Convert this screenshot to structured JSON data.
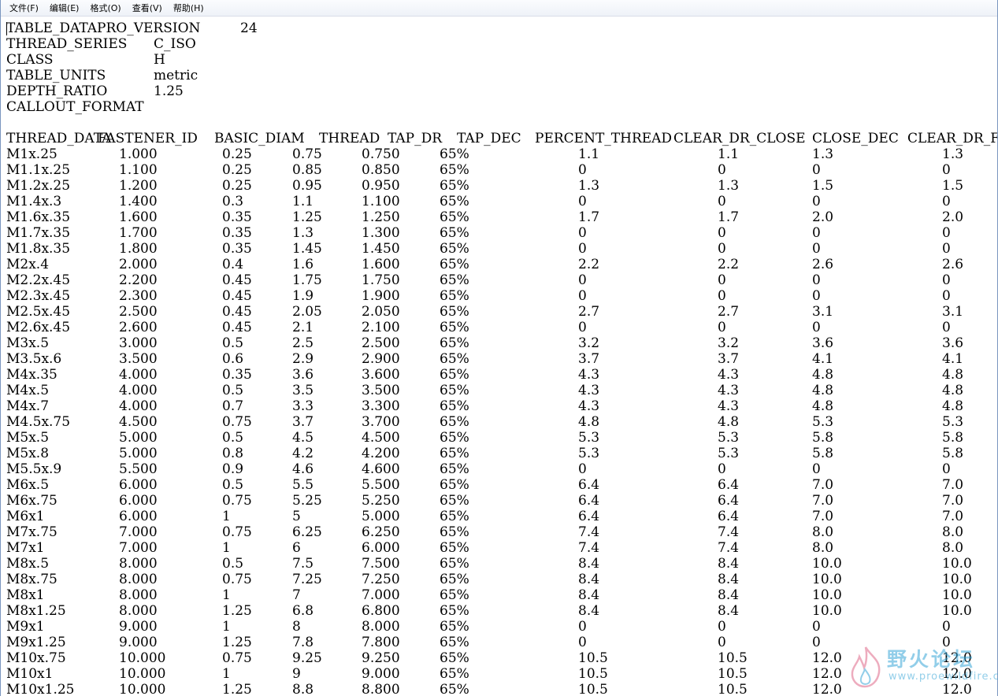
{
  "menubar": {
    "items": [
      "文件(F)",
      "编辑(E)",
      "格式(O)",
      "查看(V)",
      "帮助(H)"
    ]
  },
  "header_rows": [
    {
      "key": "TABLE_DATAPRO_VERSION",
      "value": "24"
    },
    {
      "key": "THREAD_SERIES",
      "value": "C_ISO"
    },
    {
      "key": "CLASS",
      "value": "H"
    },
    {
      "key": "TABLE_UNITS",
      "value": "metric"
    },
    {
      "key": "DEPTH_RATIO",
      "value": "1.25"
    },
    {
      "key": "CALLOUT_FORMAT",
      "value": ""
    }
  ],
  "table": {
    "columns": [
      "THREAD_DATA",
      "FASTENER_ID",
      "BASIC_DIAM",
      "THREAD",
      "TAP_DR",
      "TAP_DEC",
      "PERCENT_THREAD",
      "CLEAR_DR_CLOSE",
      "CLOSE_DEC",
      "CLEAR_DR_FR"
    ],
    "rows": [
      [
        "M1x.25",
        "1.000",
        "0.25",
        "0.75",
        "0.750",
        "65%",
        "1.1",
        "1.1",
        "1.3",
        "1.3"
      ],
      [
        "M1.1x.25",
        "1.100",
        "0.25",
        "0.85",
        "0.850",
        "65%",
        "0",
        "0",
        "0",
        "0"
      ],
      [
        "M1.2x.25",
        "1.200",
        "0.25",
        "0.95",
        "0.950",
        "65%",
        "1.3",
        "1.3",
        "1.5",
        "1.5"
      ],
      [
        "M1.4x.3",
        "1.400",
        "0.3",
        "1.1",
        "1.100",
        "65%",
        "0",
        "0",
        "0",
        "0"
      ],
      [
        "M1.6x.35",
        "1.600",
        "0.35",
        "1.25",
        "1.250",
        "65%",
        "1.7",
        "1.7",
        "2.0",
        "2.0"
      ],
      [
        "M1.7x.35",
        "1.700",
        "0.35",
        "1.3",
        "1.300",
        "65%",
        "0",
        "0",
        "0",
        "0"
      ],
      [
        "M1.8x.35",
        "1.800",
        "0.35",
        "1.45",
        "1.450",
        "65%",
        "0",
        "0",
        "0",
        "0"
      ],
      [
        "M2x.4",
        "2.000",
        "0.4",
        "1.6",
        "1.600",
        "65%",
        "2.2",
        "2.2",
        "2.6",
        "2.6"
      ],
      [
        "M2.2x.45",
        "2.200",
        "0.45",
        "1.75",
        "1.750",
        "65%",
        "0",
        "0",
        "0",
        "0"
      ],
      [
        "M2.3x.45",
        "2.300",
        "0.45",
        "1.9",
        "1.900",
        "65%",
        "0",
        "0",
        "0",
        "0"
      ],
      [
        "M2.5x.45",
        "2.500",
        "0.45",
        "2.05",
        "2.050",
        "65%",
        "2.7",
        "2.7",
        "3.1",
        "3.1"
      ],
      [
        "M2.6x.45",
        "2.600",
        "0.45",
        "2.1",
        "2.100",
        "65%",
        "0",
        "0",
        "0",
        "0"
      ],
      [
        "M3x.5",
        "3.000",
        "0.5",
        "2.5",
        "2.500",
        "65%",
        "3.2",
        "3.2",
        "3.6",
        "3.6"
      ],
      [
        "M3.5x.6",
        "3.500",
        "0.6",
        "2.9",
        "2.900",
        "65%",
        "3.7",
        "3.7",
        "4.1",
        "4.1"
      ],
      [
        "M4x.35",
        "4.000",
        "0.35",
        "3.6",
        "3.600",
        "65%",
        "4.3",
        "4.3",
        "4.8",
        "4.8"
      ],
      [
        "M4x.5",
        "4.000",
        "0.5",
        "3.5",
        "3.500",
        "65%",
        "4.3",
        "4.3",
        "4.8",
        "4.8"
      ],
      [
        "M4x.7",
        "4.000",
        "0.7",
        "3.3",
        "3.300",
        "65%",
        "4.3",
        "4.3",
        "4.8",
        "4.8"
      ],
      [
        "M4.5x.75",
        "4.500",
        "0.75",
        "3.7",
        "3.700",
        "65%",
        "4.8",
        "4.8",
        "5.3",
        "5.3"
      ],
      [
        "M5x.5",
        "5.000",
        "0.5",
        "4.5",
        "4.500",
        "65%",
        "5.3",
        "5.3",
        "5.8",
        "5.8"
      ],
      [
        "M5x.8",
        "5.000",
        "0.8",
        "4.2",
        "4.200",
        "65%",
        "5.3",
        "5.3",
        "5.8",
        "5.8"
      ],
      [
        "M5.5x.9",
        "5.500",
        "0.9",
        "4.6",
        "4.600",
        "65%",
        "0",
        "0",
        "0",
        "0"
      ],
      [
        "M6x.5",
        "6.000",
        "0.5",
        "5.5",
        "5.500",
        "65%",
        "6.4",
        "6.4",
        "7.0",
        "7.0"
      ],
      [
        "M6x.75",
        "6.000",
        "0.75",
        "5.25",
        "5.250",
        "65%",
        "6.4",
        "6.4",
        "7.0",
        "7.0"
      ],
      [
        "M6x1",
        "6.000",
        "1",
        "5",
        "5.000",
        "65%",
        "6.4",
        "6.4",
        "7.0",
        "7.0"
      ],
      [
        "M7x.75",
        "7.000",
        "0.75",
        "6.25",
        "6.250",
        "65%",
        "7.4",
        "7.4",
        "8.0",
        "8.0"
      ],
      [
        "M7x1",
        "7.000",
        "1",
        "6",
        "6.000",
        "65%",
        "7.4",
        "7.4",
        "8.0",
        "8.0"
      ],
      [
        "M8x.5",
        "8.000",
        "0.5",
        "7.5",
        "7.500",
        "65%",
        "8.4",
        "8.4",
        "10.0",
        "10.0"
      ],
      [
        "M8x.75",
        "8.000",
        "0.75",
        "7.25",
        "7.250",
        "65%",
        "8.4",
        "8.4",
        "10.0",
        "10.0"
      ],
      [
        "M8x1",
        "8.000",
        "1",
        "7",
        "7.000",
        "65%",
        "8.4",
        "8.4",
        "10.0",
        "10.0"
      ],
      [
        "M8x1.25",
        "8.000",
        "1.25",
        "6.8",
        "6.800",
        "65%",
        "8.4",
        "8.4",
        "10.0",
        "10.0"
      ],
      [
        "M9x1",
        "9.000",
        "1",
        "8",
        "8.000",
        "65%",
        "0",
        "0",
        "0",
        "0"
      ],
      [
        "M9x1.25",
        "9.000",
        "1.25",
        "7.8",
        "7.800",
        "65%",
        "0",
        "0",
        "0",
        "0"
      ],
      [
        "M10x.75",
        "10.000",
        "0.75",
        "9.25",
        "9.250",
        "65%",
        "10.5",
        "10.5",
        "12.0",
        "12.0"
      ],
      [
        "M10x1",
        "10.000",
        "1",
        "9",
        "9.000",
        "65%",
        "10.5",
        "10.5",
        "12.0",
        "12.0"
      ],
      [
        "M10x1.25",
        "10.000",
        "1.25",
        "8.8",
        "8.800",
        "65%",
        "10.5",
        "10.5",
        "12.0",
        "12.0"
      ]
    ]
  },
  "watermark": {
    "text": "野火论坛",
    "url": "www.proewildfire.cn"
  }
}
